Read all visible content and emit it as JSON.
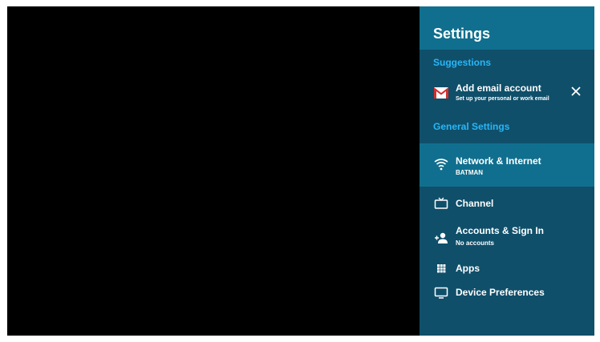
{
  "settings": {
    "title": "Settings",
    "suggestions_label": "Suggestions",
    "suggestion": {
      "title": "Add email account",
      "subtitle": "Set up your personal or work email",
      "icon": "gmail-icon",
      "dismiss_icon": "close-icon"
    },
    "general_label": "General Settings",
    "items": [
      {
        "label": "Network & Internet",
        "sublabel": "BATMAN",
        "icon": "wifi-icon",
        "selected": true
      },
      {
        "label": "Channel",
        "sublabel": "",
        "icon": "tv-icon",
        "selected": false
      },
      {
        "label": "Accounts & Sign In",
        "sublabel": "No accounts",
        "icon": "add-person-icon",
        "selected": false
      },
      {
        "label": "Apps",
        "sublabel": "",
        "icon": "apps-grid-icon",
        "selected": false
      },
      {
        "label": "Device Preferences",
        "sublabel": "",
        "icon": "monitor-icon",
        "selected": false
      }
    ]
  },
  "colors": {
    "panel_background": "#0f4f6a",
    "header_background": "#106f8e",
    "selected_background": "#106f8e",
    "section_label": "#29b6f6",
    "text": "#ffffff",
    "mail_red": "#d32f2f"
  }
}
